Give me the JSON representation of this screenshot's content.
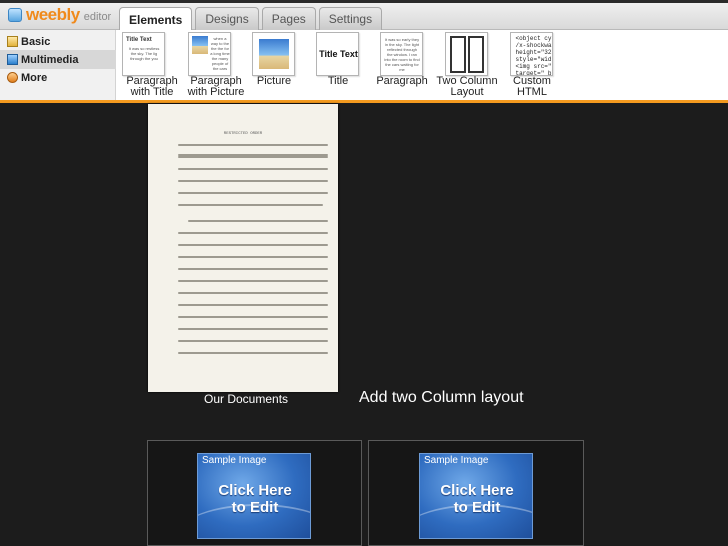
{
  "app": {
    "logo_word": "weebly",
    "logo_sub": "editor"
  },
  "tabs": [
    {
      "label": "Elements",
      "active": true
    },
    {
      "label": "Designs"
    },
    {
      "label": "Pages"
    },
    {
      "label": "Settings"
    }
  ],
  "sidebar": {
    "items": [
      {
        "label": "Basic"
      },
      {
        "label": "Multimedia",
        "selected": true
      },
      {
        "label": "More"
      }
    ]
  },
  "elements": [
    {
      "label": "Paragraph\nwith Title",
      "thumb_title": "Title Text",
      "thumb_text": "It was so restless the sky. The lig through the you"
    },
    {
      "label": "Paragraph\nwith Picture",
      "thumb_text": "when a way to the the the for a long time the many people of the cars"
    },
    {
      "label": "Picture"
    },
    {
      "label": "Title",
      "thumb_title": "Title Text"
    },
    {
      "label": "Paragraph",
      "thumb_text": "It was so early they in the sky. The light reflected through the window. I ran into the room to find the cars waiting for me"
    },
    {
      "label": "Two Column\nLayout"
    },
    {
      "label": "Custom\nHTML",
      "thumb_code": "<object cy\n/x-shockwa\nheight=\"32\nstyle=\"wid\n<img src=\"\ntarget=\"_b"
    }
  ],
  "canvas": {
    "document_heading": "RESTRICTED ORDER",
    "document_caption": "Our Documents",
    "add_text": "Add two Column layout",
    "columns": [
      {
        "image_header": "Sample Image",
        "cta": "Click Here\nto Edit"
      },
      {
        "image_header": "Sample Image",
        "cta": "Click Here\nto Edit"
      }
    ]
  },
  "colors": {
    "accent": "#f39a1f",
    "background": "#1c1c1c",
    "brand": "#f08a1c"
  }
}
